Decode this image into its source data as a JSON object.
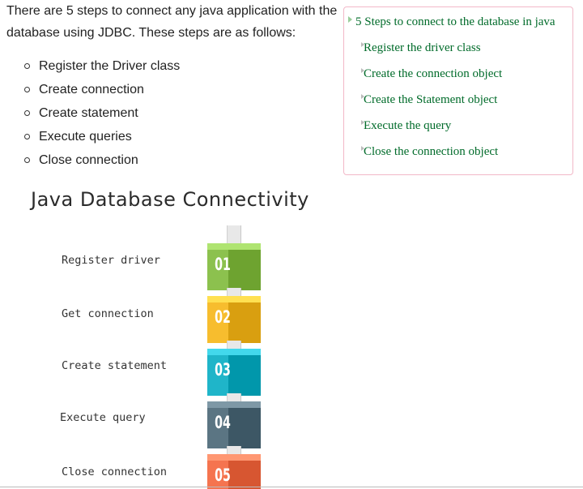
{
  "intro": "There are 5 steps to connect any java application with the database using JDBC. These steps are as follows:",
  "steps": [
    "Register the Driver class",
    "Create connection",
    "Create statement",
    "Execute queries",
    "Close connection"
  ],
  "toc": {
    "title": "5 Steps to connect to the database in java",
    "items": [
      "Register the driver class",
      "Create the connection object",
      "Create the Statement object",
      "Execute the query",
      "Close the connection object"
    ]
  },
  "diagram": {
    "title": "Java Database Connectivity",
    "labels": [
      "Register driver",
      "Get connection",
      "Create statement",
      "Execute query",
      "Close connection"
    ],
    "numbers": [
      "01",
      "02",
      "03",
      "04",
      "05"
    ],
    "colors": [
      "#8cc14e",
      "#f7bd2e",
      "#1fb5c9",
      "#5b7583",
      "#f5744f"
    ]
  }
}
